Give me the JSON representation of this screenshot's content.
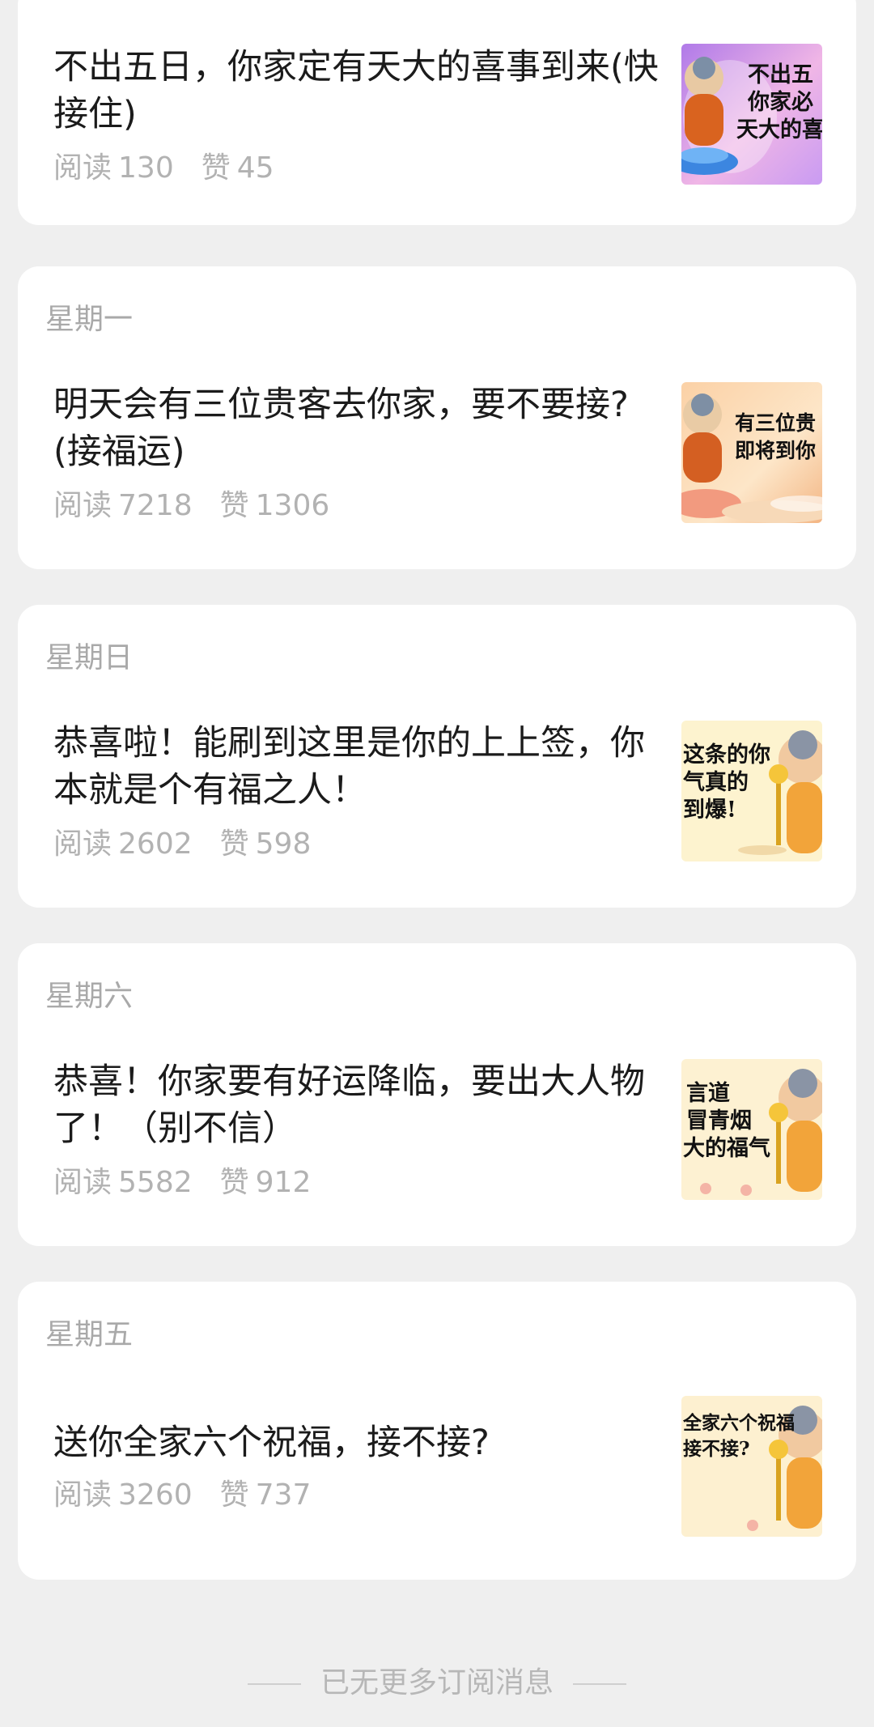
{
  "articles": [
    {
      "day": "",
      "title": "不出五日，你家定有天大的喜事到来(快接住)",
      "read_label": "阅读",
      "reads": "130",
      "like_label": "赞",
      "likes": "45",
      "thumb_lines": [
        "不出五",
        "你家必",
        "天大的喜"
      ],
      "thumb_icon": "buddha-lotus-image"
    },
    {
      "day": "星期一",
      "title": "明天会有三位贵客去你家，要不要接?(接福运)",
      "read_label": "阅读",
      "reads": "7218",
      "like_label": "赞",
      "likes": "1306",
      "thumb_lines": [
        "有三位贵",
        "即将到你"
      ],
      "thumb_icon": "buddha-cloud-image"
    },
    {
      "day": "星期日",
      "title": "恭喜啦！能刷到这里是你的上上签，你本就是个有福之人！",
      "read_label": "阅读",
      "reads": "2602",
      "like_label": "赞",
      "likes": "598",
      "thumb_lines": [
        "这条的你",
        "气真的",
        "到爆!"
      ],
      "thumb_icon": "buddha-scepter-image"
    },
    {
      "day": "星期六",
      "title": "恭喜！你家要有好运降临，要出大人物了！（别不信）",
      "read_label": "阅读",
      "reads": "5582",
      "like_label": "赞",
      "likes": "912",
      "thumb_lines": [
        "言道",
        "冒青烟",
        "大的福气"
      ],
      "thumb_icon": "buddha-scepter-image"
    },
    {
      "day": "星期五",
      "title": "送你全家六个祝福，接不接?",
      "read_label": "阅读",
      "reads": "3260",
      "like_label": "赞",
      "likes": "737",
      "thumb_lines": [
        "全家六个祝福",
        "接不接?"
      ],
      "thumb_icon": "buddha-scepter-image"
    }
  ],
  "footer": {
    "text": "已无更多订阅消息"
  },
  "colors": {
    "background": "#efefef",
    "card": "#ffffff",
    "secondary_text": "#b2b2b2"
  }
}
